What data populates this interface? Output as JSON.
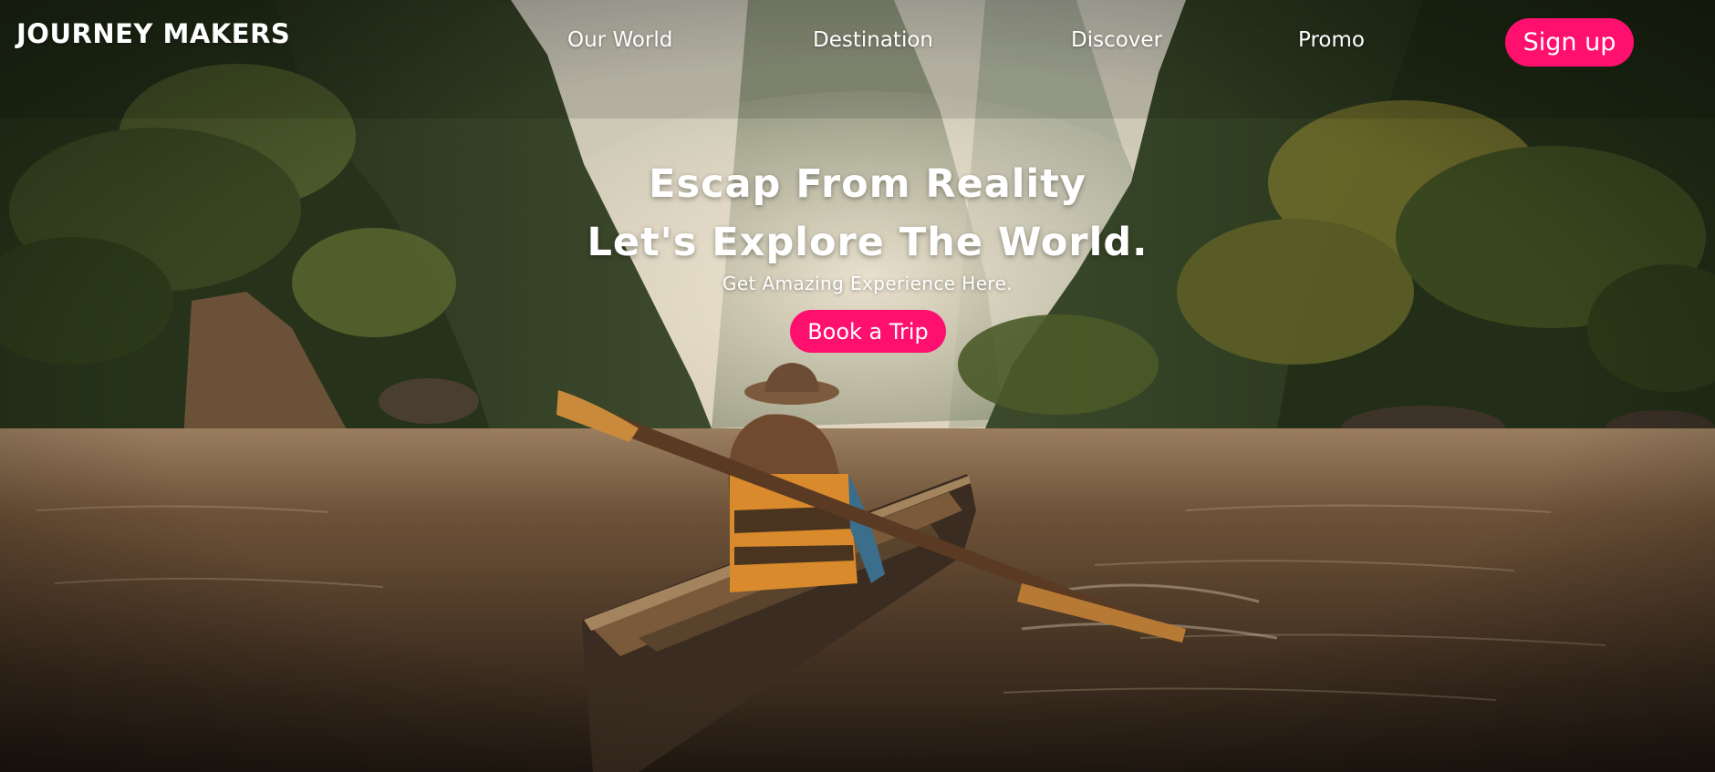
{
  "brand": {
    "name": "JOURNEY MAKERS"
  },
  "nav": {
    "items": [
      {
        "label": "Our World"
      },
      {
        "label": "Destination"
      },
      {
        "label": "Discover"
      },
      {
        "label": "Promo"
      }
    ],
    "signup_label": "Sign up"
  },
  "hero": {
    "headline_line1": "Escap From Reality",
    "headline_line2": "Let's Explore The World.",
    "subtitle": "Get Amazing Experience Here.",
    "cta_label": "Book a Trip",
    "background_image": "woman-in-hat-paddling-wooden-canoe-on-jungle-river"
  },
  "colors": {
    "accent": "#ff0f6e",
    "text": "#ffffff"
  }
}
